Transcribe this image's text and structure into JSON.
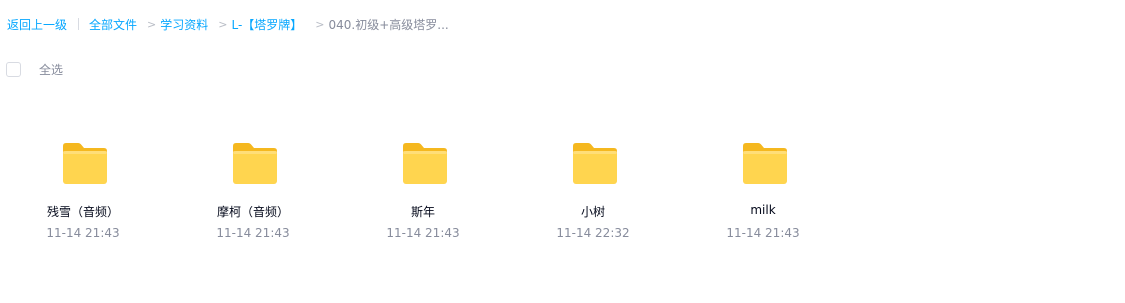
{
  "breadcrumb": {
    "back": "返回上一级",
    "items": [
      "全部文件",
      "学习资料",
      "L-【塔罗牌】"
    ],
    "current": "040.初级+高级塔罗...",
    "separator": ">"
  },
  "toolbar": {
    "select_all": "全选"
  },
  "folders": [
    {
      "name": "残雪（音频）",
      "time": "11-14 21:43"
    },
    {
      "name": "摩柯（音频）",
      "time": "11-14 21:43"
    },
    {
      "name": "斯年",
      "time": "11-14 21:43"
    },
    {
      "name": "小树",
      "time": "11-14 22:32"
    },
    {
      "name": "milk",
      "time": "11-14 21:43"
    }
  ],
  "colors": {
    "link": "#06a7ff",
    "muted": "#878c9c",
    "text": "#03081a",
    "folder_back": "#f5b81f",
    "folder_front": "#ffd54f"
  },
  "icons": {
    "folder": "folder-icon"
  }
}
